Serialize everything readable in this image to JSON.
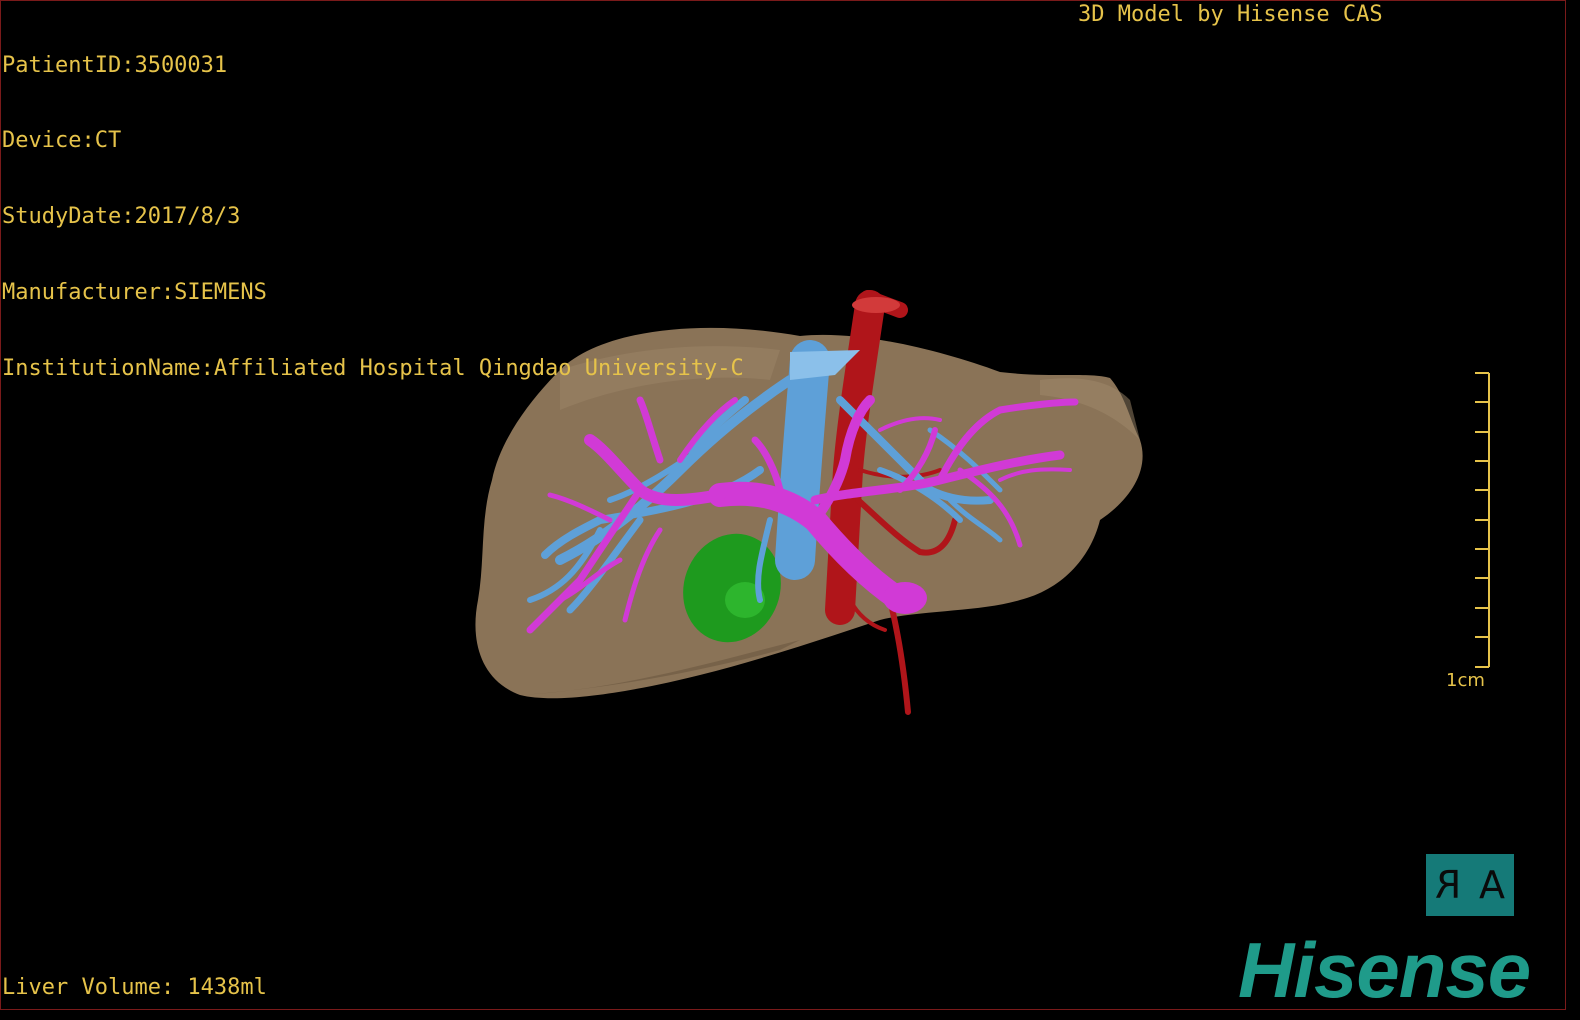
{
  "overlay": {
    "patient_id": "PatientID:3500031",
    "device": "Device:CT",
    "study_date": "StudyDate:2017/8/3",
    "manufacturer": "Manufacturer:SIEMENS",
    "institution": "InstitutionName:Affiliated Hospital Qingdao University-C",
    "credit": "3D Model by Hisense CAS",
    "liver_volume": "Liver Volume: 1438ml"
  },
  "scale_bar": {
    "label": "1cm"
  },
  "orientation": {
    "right_glyph": "R",
    "anterior_glyph": "A"
  },
  "brand": {
    "logo_text": "Hisense"
  },
  "colors": {
    "text": "#e6c34a",
    "liver": "#8a7357",
    "hepatic_vein": "#5ea0d8",
    "portal_vein": "#d13ad6",
    "artery": "#b0151a",
    "gallbladder": "#1e9a1e",
    "brand": "#1f9b8a"
  }
}
